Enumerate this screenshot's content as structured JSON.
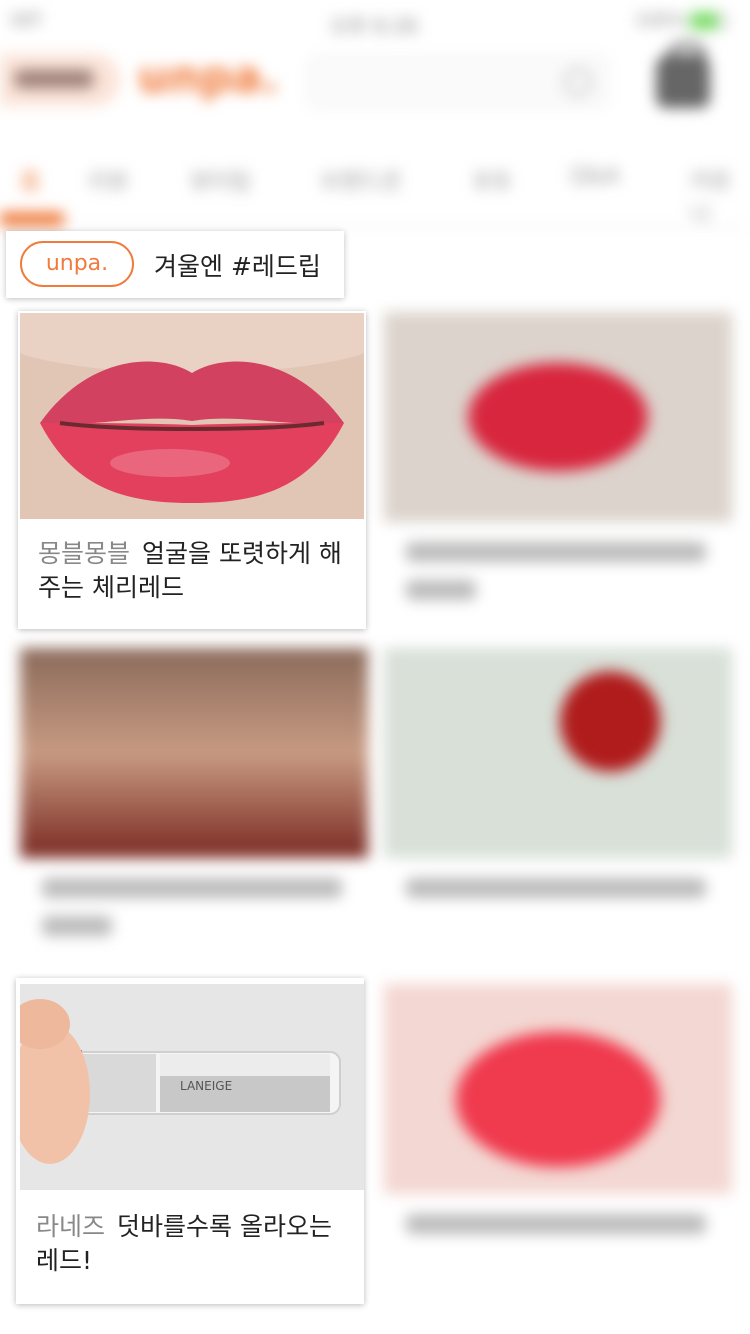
{
  "status_bar": {
    "carrier": "SKT",
    "time": "오후 6:26",
    "battery": "100%"
  },
  "header": {
    "logo": "unpa."
  },
  "tabs": [
    "홈",
    "리뷰",
    "뷰티팁",
    "브랜드관",
    "포토",
    "Q&A",
    "커뮤니"
  ],
  "feature": {
    "tag": "unpa.",
    "title": "겨울엔 #레드립"
  },
  "cards": [
    {
      "brand": "몽블몽블",
      "title": "얼굴을 또렷하게 해주는 체리레드",
      "image_icon": "red-lips-photo"
    },
    {
      "brand": "라네즈",
      "title": "덧바를수록 올라오는 레드!",
      "image_icon": "laneige-lipstick-photo"
    }
  ],
  "colors": {
    "accent": "#f07b3c",
    "lip_red": "#d83a55"
  }
}
